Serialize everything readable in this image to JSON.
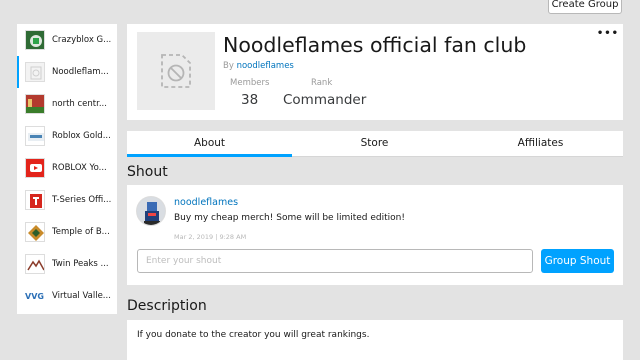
{
  "top": {
    "create_group_label": "Create Group"
  },
  "sidebar": {
    "items": [
      {
        "label": "Crazyblox G..."
      },
      {
        "label": "Noodleflam..."
      },
      {
        "label": "north centr..."
      },
      {
        "label": "Roblox Gold..."
      },
      {
        "label": "ROBLOX Yo..."
      },
      {
        "label": "T-Series Offi..."
      },
      {
        "label": "Temple of B..."
      },
      {
        "label": "Twin Peaks ..."
      },
      {
        "label": "Virtual Valle..."
      }
    ]
  },
  "group": {
    "name": "Noodleflames official fan club",
    "by_prefix": "By",
    "owner": "noodleflames",
    "members_label": "Members",
    "members_value": "38",
    "rank_label": "Rank",
    "rank_value": "Commander",
    "menu": "•••"
  },
  "tabs": [
    {
      "label": "About"
    },
    {
      "label": "Store"
    },
    {
      "label": "Affiliates"
    }
  ],
  "shout": {
    "title": "Shout",
    "poster": "noodleflames",
    "text": "Buy my cheap merch! Some will be limited edition!",
    "date": "Mar 2, 2019 | 9:28 AM",
    "input_placeholder": "Enter your shout",
    "button_label": "Group Shout"
  },
  "description": {
    "title": "Description",
    "text": "If you donate to the creator you will great rankings."
  },
  "colors": {
    "accent": "#00a2ff",
    "link": "#0074bd",
    "background": "#e3e3e3"
  }
}
